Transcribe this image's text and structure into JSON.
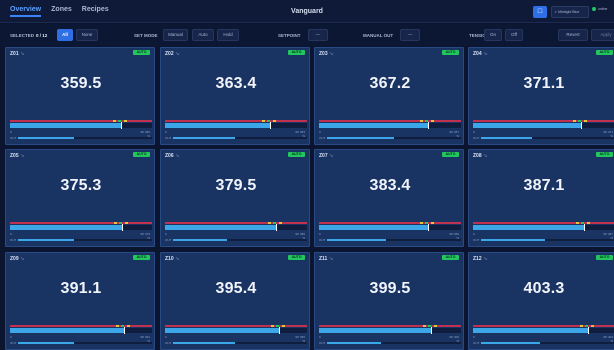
{
  "app": {
    "title": "Vanguard"
  },
  "nav": {
    "tabs": [
      "Overview",
      "Zones",
      "Recipes"
    ],
    "active": "Overview"
  },
  "header": {
    "theme_label": "◐ Midnight Blue",
    "status_label": "online"
  },
  "toolbar": {
    "selected_label": "SELECTED",
    "selected_count": "0 / 12",
    "all_label": "All",
    "none_label": "None",
    "setmode_label": "SET MODE",
    "mode_options": [
      "Manual",
      "Auto",
      "Hold"
    ],
    "setpoint_label": "SETPOINT",
    "setpoint_value": "—",
    "manual_out_label": "MANUAL OUT",
    "manual_out_value": "—",
    "tension_label": "TENSION",
    "tension_options": [
      "On",
      "Off"
    ],
    "revert_label": "Revert",
    "apply_label": "Apply"
  },
  "tile_text": {
    "unit": "°c",
    "mode": "AUTO",
    "sp_label": "SP",
    "out_label": "OUT",
    "out_unit": "%",
    "low_label": "0"
  },
  "zones": [
    {
      "id": "Z01",
      "pv": "359.5",
      "sp": "360",
      "fill": 0.78,
      "out": 0.42
    },
    {
      "id": "Z02",
      "pv": "363.4",
      "sp": "363",
      "fill": 0.74,
      "out": 0.46
    },
    {
      "id": "Z03",
      "pv": "367.2",
      "sp": "367",
      "fill": 0.77,
      "out": 0.5
    },
    {
      "id": "Z04",
      "pv": "371.1",
      "sp": "371",
      "fill": 0.76,
      "out": 0.38
    },
    {
      "id": "Z05",
      "pv": "375.3",
      "sp": "375",
      "fill": 0.79,
      "out": 0.42
    },
    {
      "id": "Z06",
      "pv": "379.5",
      "sp": "380",
      "fill": 0.78,
      "out": 0.4
    },
    {
      "id": "Z07",
      "pv": "383.4",
      "sp": "383",
      "fill": 0.77,
      "out": 0.44
    },
    {
      "id": "Z08",
      "pv": "387.1",
      "sp": "387",
      "fill": 0.78,
      "out": 0.48
    },
    {
      "id": "Z09",
      "pv": "391.1",
      "sp": "391",
      "fill": 0.8,
      "out": 0.42
    },
    {
      "id": "Z10",
      "pv": "395.4",
      "sp": "395",
      "fill": 0.8,
      "out": 0.46
    },
    {
      "id": "Z11",
      "pv": "399.5",
      "sp": "400",
      "fill": 0.79,
      "out": 0.4
    },
    {
      "id": "Z12",
      "pv": "403.3",
      "sp": "403",
      "fill": 0.81,
      "out": 0.44
    }
  ],
  "colors": {
    "accent": "#2f6fe6",
    "auto_badge": "#22c55e",
    "bar_fill": "#3ba7e8",
    "limit_band": "#c0304f",
    "tile_bg": "#193362"
  }
}
